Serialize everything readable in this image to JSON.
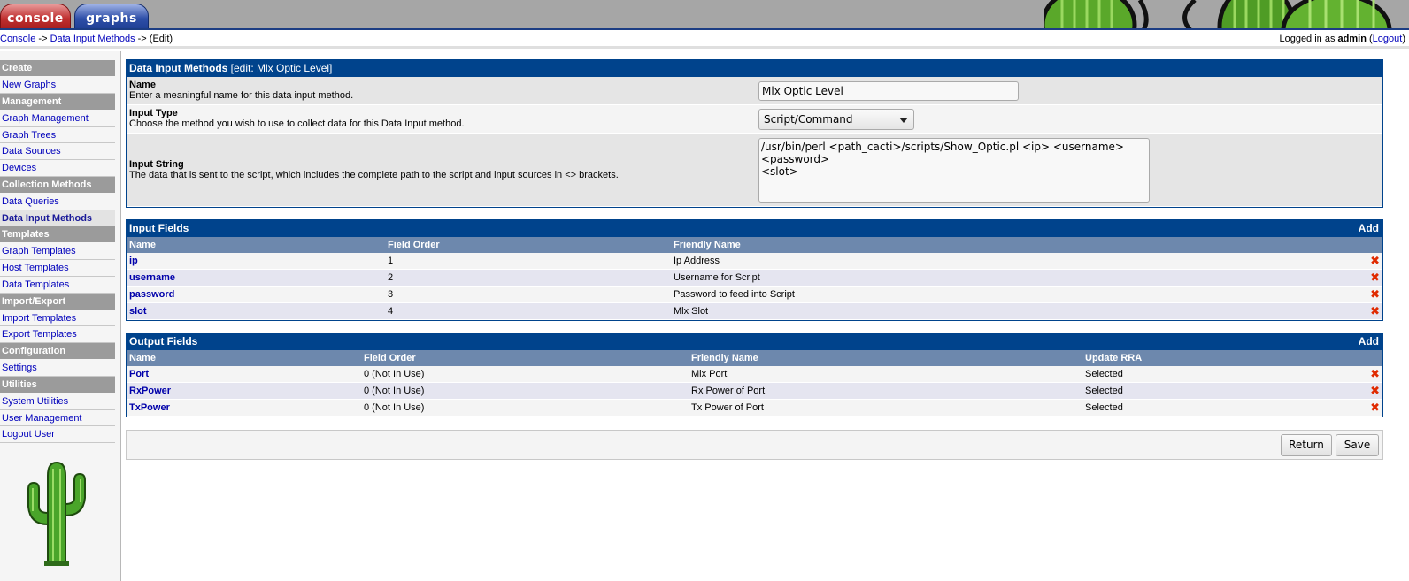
{
  "tabs": {
    "console": "console",
    "graphs": "graphs"
  },
  "breadcrumb": {
    "console": "Console",
    "sep1": " -> ",
    "dim": "Data Input Methods",
    "sep2": " -> ",
    "edit": "(Edit)"
  },
  "login": {
    "prefix": "Logged in as ",
    "user": "admin",
    "open": " (",
    "logout": "Logout",
    "close": ")"
  },
  "sidebar": {
    "create": "Create",
    "new_graphs": "New Graphs",
    "management": "Management",
    "graph_management": "Graph Management",
    "graph_trees": "Graph Trees",
    "data_sources": "Data Sources",
    "devices": "Devices",
    "collection_methods": "Collection Methods",
    "data_queries": "Data Queries",
    "data_input_methods": "Data Input Methods",
    "templates": "Templates",
    "graph_templates": "Graph Templates",
    "host_templates": "Host Templates",
    "data_templates": "Data Templates",
    "import_export": "Import/Export",
    "import_templates": "Import Templates",
    "export_templates": "Export Templates",
    "configuration": "Configuration",
    "settings": "Settings",
    "utilities": "Utilities",
    "system_utilities": "System Utilities",
    "user_management": "User Management",
    "logout_user": "Logout User"
  },
  "dim_panel": {
    "title": "Data Input Methods",
    "subtitle": " [edit: Mlx Optic Level]",
    "name_label": "Name",
    "name_desc": "Enter a meaningful name for this data input method.",
    "name_value": "Mlx Optic Level",
    "type_label": "Input Type",
    "type_desc": "Choose the method you wish to use to collect data for this Data Input method.",
    "type_value": "Script/Command",
    "string_label": "Input String",
    "string_desc": "The data that is sent to the script, which includes the complete path to the script and input sources in <> brackets.",
    "string_value": "/usr/bin/perl <path_cacti>/scripts/Show_Optic.pl <ip> <username> <password>\n<slot>"
  },
  "input_fields": {
    "title": "Input Fields",
    "add": "Add",
    "headers": [
      "Name",
      "Field Order",
      "Friendly Name"
    ],
    "rows": [
      [
        "ip",
        "1",
        "Ip Address"
      ],
      [
        "username",
        "2",
        "Username for Script"
      ],
      [
        "password",
        "3",
        "Password to feed into Script"
      ],
      [
        "slot",
        "4",
        "Mlx Slot"
      ]
    ]
  },
  "output_fields": {
    "title": "Output Fields",
    "add": "Add",
    "headers": [
      "Name",
      "Field Order",
      "Friendly Name",
      "Update RRA"
    ],
    "rows": [
      [
        "Port",
        "0 (Not In Use)",
        "Mlx Port",
        "Selected"
      ],
      [
        "RxPower",
        "0 (Not In Use)",
        "Rx Power of Port",
        "Selected"
      ],
      [
        "TxPower",
        "0 (Not In Use)",
        "Tx Power of Port",
        "Selected"
      ]
    ]
  },
  "buttons": {
    "return": "Return",
    "save": "Save"
  },
  "icons": {
    "delete": "delete-icon",
    "logo": "cactus-logo-icon"
  },
  "colors": {
    "accent": "#00438c",
    "column_header": "#6d88ad",
    "delete": "#e02a00"
  }
}
